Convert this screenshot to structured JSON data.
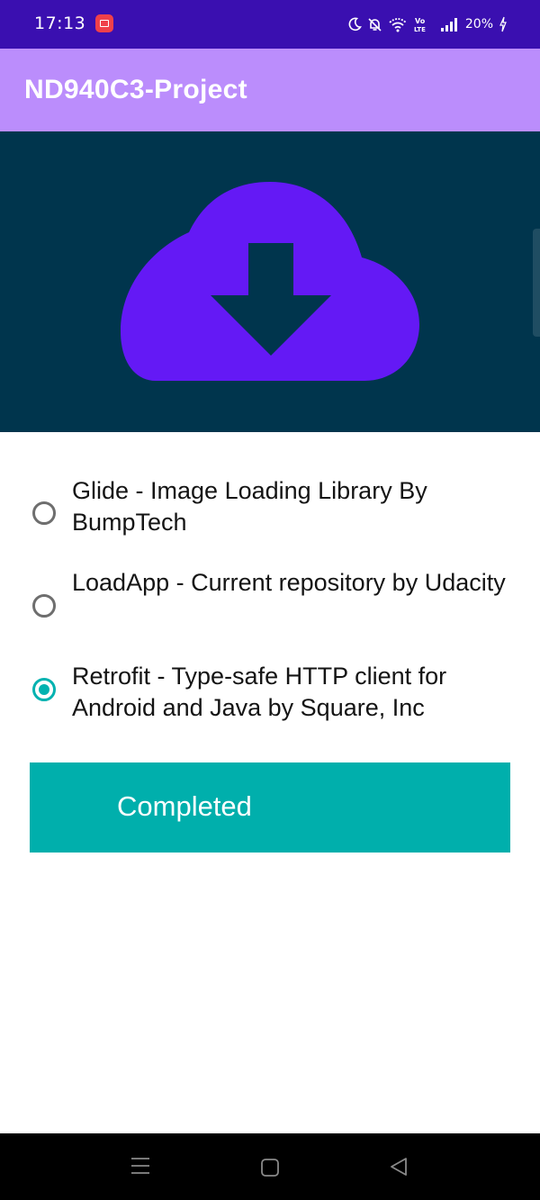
{
  "status_bar": {
    "time": "17:13",
    "battery": "20%",
    "colors": {
      "background": "#3a0fb0",
      "record": "#f0404a"
    },
    "icons": [
      "screen-record-icon",
      "moon-icon",
      "bell-off-icon",
      "wifi-icon",
      "volte-icon",
      "signal-icon",
      "charging-icon"
    ]
  },
  "app_bar": {
    "title": "ND940C3-Project",
    "color": "#bb8dfc"
  },
  "hero": {
    "icon": "cloud-download-icon",
    "background": "#00354d",
    "icon_color": "#6419f5"
  },
  "options": [
    {
      "label": "Glide - Image Loading Library By BumpTech",
      "checked": false
    },
    {
      "label": "LoadApp - Current repository by Udacity",
      "checked": false
    },
    {
      "label": "Retrofit - Type-safe HTTP client for Android and Java by Square, Inc",
      "checked": true
    }
  ],
  "button": {
    "label": "Completed",
    "color": "#00afac"
  },
  "nav_bar": {
    "icons": [
      "menu-icon",
      "home-icon",
      "back-icon"
    ]
  }
}
